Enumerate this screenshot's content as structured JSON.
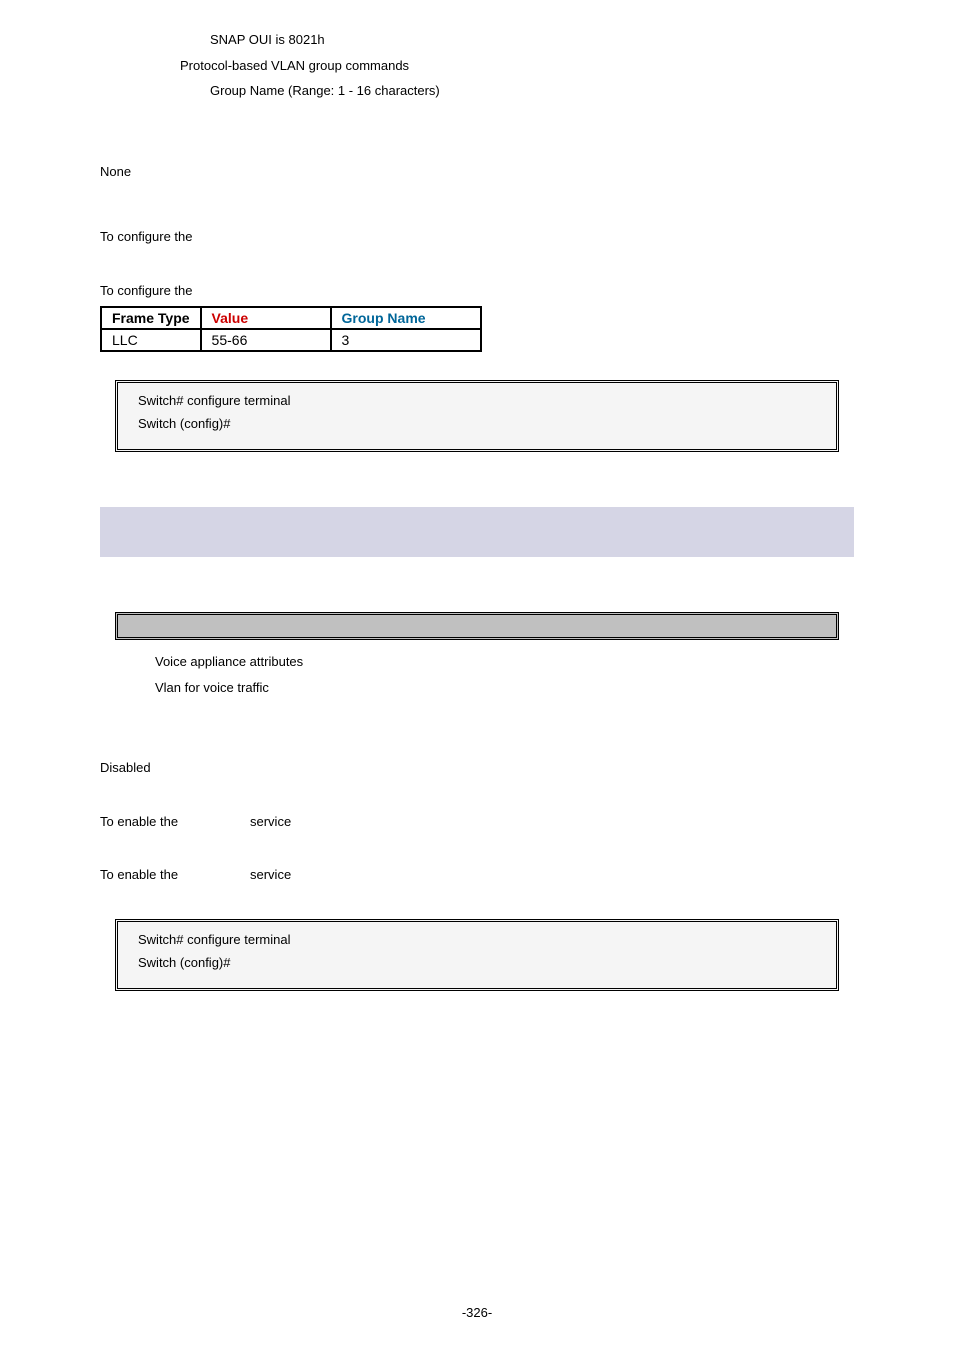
{
  "param_lines": {
    "snap_oui": "SNAP OUI is 8021h",
    "protocol_group": "Protocol-based VLAN group commands",
    "group_name": "Group Name (Range: 1 - 16 characters)"
  },
  "none": "None",
  "to_configure": "To configure the",
  "table": {
    "headers": {
      "col1": "Frame Type",
      "col2": "Value",
      "col3": "Group Name"
    },
    "row": {
      "col1": "LLC",
      "col2": "55-66",
      "col3": "3"
    }
  },
  "code1": {
    "line1": "Switch# configure terminal",
    "line2": "Switch (config)#"
  },
  "voice": {
    "attr": "Voice appliance attributes",
    "vlan": "Vlan for voice traffic"
  },
  "disabled": "Disabled",
  "enable_prefix": "To enable the",
  "enable_suffix": "service",
  "code2": {
    "line1": "Switch# configure terminal",
    "line2": "Switch (config)#"
  },
  "page_number": "-326-"
}
